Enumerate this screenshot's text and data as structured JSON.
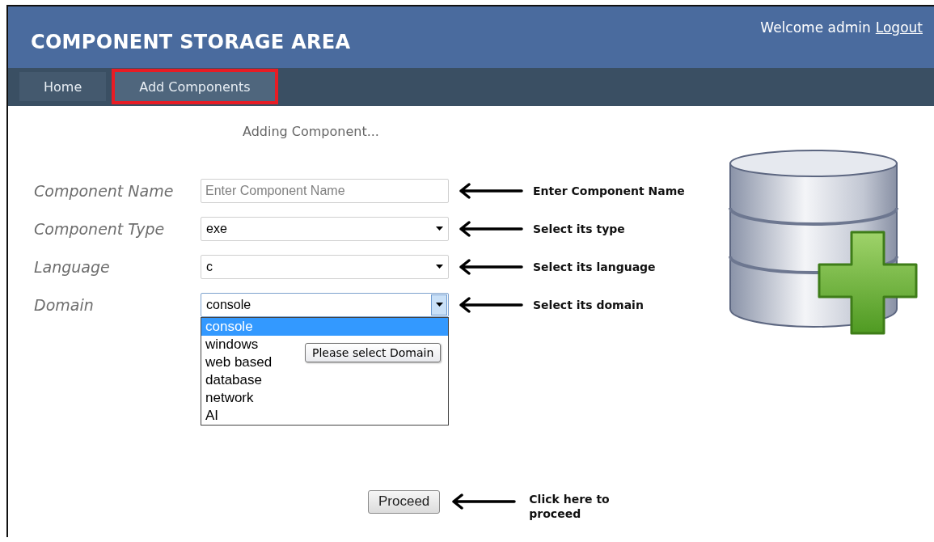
{
  "header": {
    "title": "COMPONENT STORAGE AREA",
    "welcome": "Welcome admin",
    "logout": "Logout"
  },
  "nav": {
    "tabs": [
      {
        "label": "Home",
        "selected": false,
        "highlighted": false
      },
      {
        "label": "Add Components",
        "selected": true,
        "highlighted": true
      }
    ]
  },
  "status": "Adding Component...",
  "form": {
    "fields": [
      {
        "kind": "text",
        "label": "Component Name",
        "placeholder": "Enter Component Name",
        "note": "Enter Component Name"
      },
      {
        "kind": "select",
        "label": "Component Type",
        "value": "exe",
        "open": false,
        "note": "Select its type"
      },
      {
        "kind": "select",
        "label": "Language",
        "value": "c",
        "open": false,
        "note": "Select its language"
      },
      {
        "kind": "select",
        "label": "Domain",
        "value": "console",
        "open": true,
        "note": "Select its domain",
        "options": [
          {
            "label": "console",
            "selected": true
          },
          {
            "label": "windows",
            "selected": false
          },
          {
            "label": "web based",
            "selected": false
          },
          {
            "label": "database",
            "selected": false
          },
          {
            "label": "network",
            "selected": false
          },
          {
            "label": "AI",
            "selected": false
          }
        ]
      }
    ]
  },
  "tooltip": "Please select Domain",
  "proceed": {
    "label": "Proceed",
    "note": "Click here to proceed"
  }
}
